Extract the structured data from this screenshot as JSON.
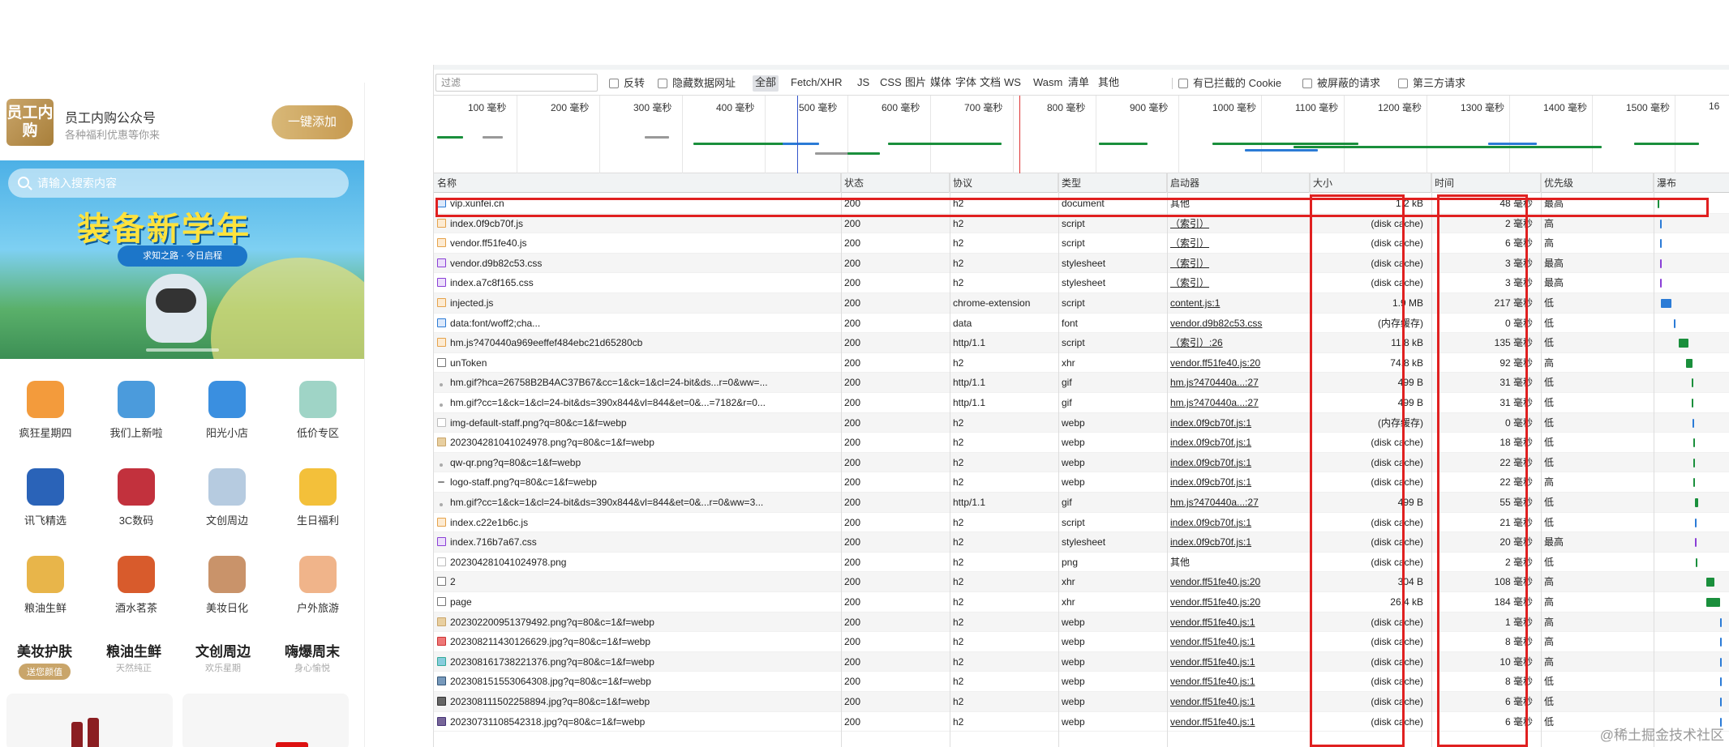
{
  "mobile": {
    "header": {
      "logo_text": "员工内购",
      "title": "员工内购公众号",
      "subtitle": "各种福利优惠等你来",
      "follow_button": "一键添加"
    },
    "search_placeholder": "请输入搜索内容",
    "banner": {
      "title": "装备新学年",
      "pill": "求知之路 · 今日启程"
    },
    "categories": [
      {
        "label": "疯狂星期四",
        "color": "#f39b3c"
      },
      {
        "label": "我们上新啦",
        "color": "#4b9bdc"
      },
      {
        "label": "阳光小店",
        "color": "#3a8fe0"
      },
      {
        "label": "低价专区",
        "color": "#9fd4c6"
      },
      {
        "label": "讯飞精选",
        "color": "#2a63b8"
      },
      {
        "label": "3C数码",
        "color": "#c2313d"
      },
      {
        "label": "文创周边",
        "color": "#b6cbe0"
      },
      {
        "label": "生日福利",
        "color": "#f3c03a"
      },
      {
        "label": "粮油生鲜",
        "color": "#e8b54a"
      },
      {
        "label": "酒水茗茶",
        "color": "#d85b2c"
      },
      {
        "label": "美妆日化",
        "color": "#c9936a"
      },
      {
        "label": "户外旅游",
        "color": "#f0b48a"
      }
    ],
    "tabs": [
      {
        "title": "美妆护肤",
        "sub": "送您颜值"
      },
      {
        "title": "粮油生鲜",
        "sub": "天然纯正"
      },
      {
        "title": "文创周边",
        "sub": "欢乐星期"
      },
      {
        "title": "嗨爆周末",
        "sub": "身心愉悦"
      }
    ]
  },
  "devtools": {
    "filter_placeholder": "过滤",
    "checks": [
      "反转",
      "隐藏数据网址"
    ],
    "types": [
      "全部",
      "Fetch/XHR",
      "JS",
      "CSS",
      "图片",
      "媒体",
      "字体",
      "文档",
      "WS",
      "Wasm",
      "清单",
      "其他"
    ],
    "active_type": "全部",
    "checks_right": [
      "有已拦截的 Cookie",
      "被屏蔽的请求",
      "第三方请求"
    ],
    "timeline_ticks": [
      "100 毫秒",
      "200 毫秒",
      "300 毫秒",
      "400 毫秒",
      "500 毫秒",
      "600 毫秒",
      "700 毫秒",
      "800 毫秒",
      "900 毫秒",
      "1000 毫秒",
      "1100 毫秒",
      "1200 毫秒",
      "1300 毫秒",
      "1400 毫秒",
      "1500 毫秒",
      "16"
    ],
    "columns": [
      "名称",
      "状态",
      "协议",
      "类型",
      "启动器",
      "大小",
      "时间",
      "优先级",
      "瀑布"
    ],
    "rows": [
      {
        "name": "vip.xunfei.cn",
        "status": "200",
        "protocol": "h2",
        "type": "document",
        "initiator": "其他",
        "size": "1.2 kB",
        "time": "48 毫秒",
        "priority": "最高",
        "icon": "doc",
        "link": false,
        "wf": [
          0.01,
          0.03
        ],
        "wfc": "#1a8f3c"
      },
      {
        "name": "index.0f9cb70f.js",
        "status": "200",
        "protocol": "h2",
        "type": "script",
        "initiator": "（索引）",
        "size": "(disk cache)",
        "time": "2 毫秒",
        "priority": "高",
        "icon": "js",
        "link": true,
        "wf": [
          0.05,
          0.01
        ],
        "wfc": "#2b7bd6"
      },
      {
        "name": "vendor.ff51fe40.js",
        "status": "200",
        "protocol": "h2",
        "type": "script",
        "initiator": "（索引）",
        "size": "(disk cache)",
        "time": "6 毫秒",
        "priority": "高",
        "icon": "js",
        "link": true,
        "wf": [
          0.05,
          0.01
        ],
        "wfc": "#2b7bd6"
      },
      {
        "name": "vendor.d9b82c53.css",
        "status": "200",
        "protocol": "h2",
        "type": "stylesheet",
        "initiator": "（索引）",
        "size": "(disk cache)",
        "time": "3 毫秒",
        "priority": "最高",
        "icon": "css",
        "link": true,
        "wf": [
          0.05,
          0.01
        ],
        "wfc": "#8a3fd6"
      },
      {
        "name": "index.a7c8f165.css",
        "status": "200",
        "protocol": "h2",
        "type": "stylesheet",
        "initiator": "（索引）",
        "size": "(disk cache)",
        "time": "3 毫秒",
        "priority": "最高",
        "icon": "css",
        "link": true,
        "wf": [
          0.05,
          0.01
        ],
        "wfc": "#8a3fd6"
      },
      {
        "name": "injected.js",
        "status": "200",
        "protocol": "chrome-extension",
        "type": "script",
        "initiator": "content.js:1",
        "size": "1.9 MB",
        "time": "217 毫秒",
        "priority": "低",
        "icon": "js",
        "link": true,
        "wf": [
          0.06,
          0.15
        ],
        "wfc": "#2b7bd6"
      },
      {
        "name": "data:font/woff2;cha...",
        "status": "200",
        "protocol": "data",
        "type": "font",
        "initiator": "vendor.d9b82c53.css",
        "size": "(内存缓存)",
        "time": "0 毫秒",
        "priority": "低",
        "icon": "font",
        "link": true,
        "wf": [
          0.25,
          0.01
        ],
        "wfc": "#2b7bd6"
      },
      {
        "name": "hm.js?470440a969eeffef484ebc21d65280cb",
        "status": "200",
        "protocol": "http/1.1",
        "type": "script",
        "initiator": "（索引）:26",
        "size": "11.8 kB",
        "time": "135 毫秒",
        "priority": "低",
        "icon": "js",
        "link": true,
        "wf": [
          0.32,
          0.14
        ],
        "wfc": "#1a8f3c"
      },
      {
        "name": "unToken",
        "status": "200",
        "protocol": "h2",
        "type": "xhr",
        "initiator": "vendor.ff51fe40.js:20",
        "size": "74.8 kB",
        "time": "92 毫秒",
        "priority": "高",
        "icon": "xhr",
        "link": true,
        "wf": [
          0.42,
          0.1
        ],
        "wfc": "#1a8f3c"
      },
      {
        "name": "hm.gif?hca=26758B2B4AC37B67&cc=1&ck=1&cl=24-bit&ds...r=0&ww=...",
        "status": "200",
        "protocol": "http/1.1",
        "type": "gif",
        "initiator": "hm.js?470440a...:27",
        "size": "499 B",
        "time": "31 毫秒",
        "priority": "低",
        "icon": "dot",
        "link": true,
        "wf": [
          0.5,
          0.03
        ],
        "wfc": "#1a8f3c"
      },
      {
        "name": "hm.gif?cc=1&ck=1&cl=24-bit&ds=390x844&vl=844&et=0&...=7182&r=0...",
        "status": "200",
        "protocol": "http/1.1",
        "type": "gif",
        "initiator": "hm.js?470440a...:27",
        "size": "499 B",
        "time": "31 毫秒",
        "priority": "低",
        "icon": "dot",
        "link": true,
        "wf": [
          0.5,
          0.03
        ],
        "wfc": "#1a8f3c"
      },
      {
        "name": "img-default-staff.png?q=80&c=1&f=webp",
        "status": "200",
        "protocol": "h2",
        "type": "webp",
        "initiator": "index.0f9cb70f.js:1",
        "size": "(内存缓存)",
        "time": "0 毫秒",
        "priority": "低",
        "icon": "blank",
        "link": true,
        "wf": [
          0.52,
          0.01
        ],
        "wfc": "#2b7bd6"
      },
      {
        "name": "20230428104102497​8.png?q=80&c=1&f=webp",
        "status": "200",
        "protocol": "h2",
        "type": "webp",
        "initiator": "index.0f9cb70f.js:1",
        "size": "(disk cache)",
        "time": "18 毫秒",
        "priority": "低",
        "icon": "img",
        "link": true,
        "wf": [
          0.53,
          0.02
        ],
        "wfc": "#1a8f3c"
      },
      {
        "name": "qw-qr.png?q=80&c=1&f=webp",
        "status": "200",
        "protocol": "h2",
        "type": "webp",
        "initiator": "index.0f9cb70f.js:1",
        "size": "(disk cache)",
        "time": "22 毫秒",
        "priority": "低",
        "icon": "dot",
        "link": true,
        "wf": [
          0.53,
          0.02
        ],
        "wfc": "#1a8f3c"
      },
      {
        "name": "logo-staff.png?q=80&c=1&f=webp",
        "status": "200",
        "protocol": "h2",
        "type": "webp",
        "initiator": "index.0f9cb70f.js:1",
        "size": "(disk cache)",
        "time": "22 毫秒",
        "priority": "高",
        "icon": "dash",
        "link": true,
        "wf": [
          0.53,
          0.02
        ],
        "wfc": "#1a8f3c"
      },
      {
        "name": "hm.gif?cc=1&ck=1&cl=24-bit&ds=390x844&vl=844&et=0&...r=0&ww=3...",
        "status": "200",
        "protocol": "http/1.1",
        "type": "gif",
        "initiator": "hm.js?470440a...:27",
        "size": "499 B",
        "time": "55 毫秒",
        "priority": "低",
        "icon": "dot",
        "link": true,
        "wf": [
          0.55,
          0.05
        ],
        "wfc": "#1a8f3c"
      },
      {
        "name": "index.c22e1b6c.js",
        "status": "200",
        "protocol": "h2",
        "type": "script",
        "initiator": "index.0f9cb70f.js:1",
        "size": "(disk cache)",
        "time": "21 毫秒",
        "priority": "低",
        "icon": "js",
        "link": true,
        "wf": [
          0.55,
          0.02
        ],
        "wfc": "#2b7bd6"
      },
      {
        "name": "index.716b7a67.css",
        "status": "200",
        "protocol": "h2",
        "type": "stylesheet",
        "initiator": "index.0f9cb70f.js:1",
        "size": "(disk cache)",
        "time": "20 毫秒",
        "priority": "最高",
        "icon": "css",
        "link": true,
        "wf": [
          0.55,
          0.02
        ],
        "wfc": "#8a3fd6"
      },
      {
        "name": "20230428104102497​8.png",
        "status": "200",
        "protocol": "h2",
        "type": "png",
        "initiator": "其他",
        "size": "(disk cache)",
        "time": "2 毫秒",
        "priority": "低",
        "icon": "blank",
        "link": false,
        "wf": [
          0.56,
          0.01
        ],
        "wfc": "#1a8f3c"
      },
      {
        "name": "2",
        "status": "200",
        "protocol": "h2",
        "type": "xhr",
        "initiator": "vendor.ff51fe40.js:20",
        "size": "304 B",
        "time": "108 毫秒",
        "priority": "高",
        "icon": "xhr",
        "link": true,
        "wf": [
          0.72,
          0.12
        ],
        "wfc": "#1a8f3c"
      },
      {
        "name": "page",
        "status": "200",
        "protocol": "h2",
        "type": "xhr",
        "initiator": "vendor.ff51fe40.js:20",
        "size": "26.4 kB",
        "time": "184 毫秒",
        "priority": "高",
        "icon": "xhr",
        "link": true,
        "wf": [
          0.72,
          0.2
        ],
        "wfc": "#1a8f3c"
      },
      {
        "name": "20230220095137​9492.png?q=80&c=1&f=webp",
        "status": "200",
        "protocol": "h2",
        "type": "webp",
        "initiator": "vendor.ff51fe40.js:1",
        "size": "(disk cache)",
        "time": "1 毫秒",
        "priority": "高",
        "icon": "img",
        "link": true,
        "wf": [
          0.92,
          0.01
        ],
        "wfc": "#2b7bd6"
      },
      {
        "name": "20230821143012​6629.jpg?q=80&c=1&f=webp",
        "status": "200",
        "protocol": "h2",
        "type": "webp",
        "initiator": "vendor.ff51fe40.js:1",
        "size": "(disk cache)",
        "time": "8 毫秒",
        "priority": "高",
        "icon": "imgr",
        "link": true,
        "wf": [
          0.92,
          0.01
        ],
        "wfc": "#2b7bd6"
      },
      {
        "name": "20230816173822​1376.png?q=80&c=1&f=webp",
        "status": "200",
        "protocol": "h2",
        "type": "webp",
        "initiator": "vendor.ff51fe40.js:1",
        "size": "(disk cache)",
        "time": "10 毫秒",
        "priority": "高",
        "icon": "imgg",
        "link": true,
        "wf": [
          0.92,
          0.01
        ],
        "wfc": "#2b7bd6"
      },
      {
        "name": "20230815155306​4308.jpg?q=80&c=1&f=webp",
        "status": "200",
        "protocol": "h2",
        "type": "webp",
        "initiator": "vendor.ff51fe40.js:1",
        "size": "(disk cache)",
        "time": "8 毫秒",
        "priority": "低",
        "icon": "imgb",
        "link": true,
        "wf": [
          0.92,
          0.01
        ],
        "wfc": "#2b7bd6"
      },
      {
        "name": "20230811150225​8894.jpg?q=80&c=1&f=webp",
        "status": "200",
        "protocol": "h2",
        "type": "webp",
        "initiator": "vendor.ff51fe40.js:1",
        "size": "(disk cache)",
        "time": "6 毫秒",
        "priority": "低",
        "icon": "imgd",
        "link": true,
        "wf": [
          0.92,
          0.01
        ],
        "wfc": "#2b7bd6"
      },
      {
        "name": "20230731108542318.jpg?q=80&c=1&f=webp",
        "status": "200",
        "protocol": "h2",
        "type": "webp",
        "initiator": "vendor.ff51fe40.js:1",
        "size": "(disk cache)",
        "time": "6 毫秒",
        "priority": "低",
        "icon": "imgp",
        "link": true,
        "wf": [
          0.92,
          0.01
        ],
        "wfc": "#2b7bd6"
      }
    ]
  },
  "watermark": "@稀土掘金技术社区"
}
